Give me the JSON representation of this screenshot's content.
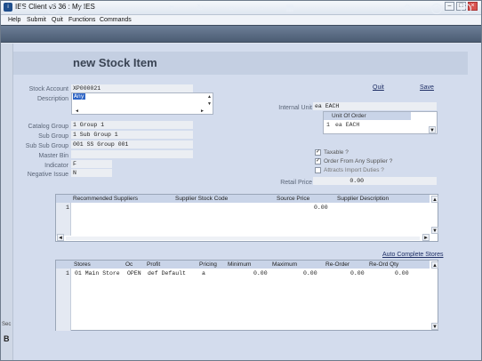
{
  "window": {
    "title": "IES Client v8.36 : My IES"
  },
  "menu": [
    "Help",
    "Submit",
    "Quit",
    "Functions",
    "Commands"
  ],
  "toolbar_icons": [
    "key-icon",
    "help-icon",
    "search-icon",
    "heart-icon",
    "refresh-icon",
    "first-icon",
    "last-icon",
    "grid-icon",
    "settings-icon",
    "confirm-icon",
    "close-icon"
  ],
  "left_strip": {
    "sec": "Sec",
    "b": "B"
  },
  "page": {
    "title": "new Stock Item",
    "quit": "Quit",
    "save": "Save"
  },
  "form": {
    "stock_account": {
      "label": "Stock Account",
      "value": "XP000021"
    },
    "description": {
      "label": "Description",
      "value": "Any"
    },
    "internal_unit": {
      "label": "Internal Unit",
      "value": "ea EACH"
    },
    "unit_of_order": {
      "header": "Unit Of Order",
      "row_num": "1",
      "value": "ea EACH"
    },
    "catalog_group": {
      "label": "Catalog Group",
      "value": "1 Group 1"
    },
    "sub_group": {
      "label": "Sub Group",
      "value": "1 Sub Group 1"
    },
    "sub_sub_group": {
      "label": "Sub Sub Group",
      "value": "001 SS Group 001"
    },
    "master_bin": {
      "label": "Master Bin",
      "value": ""
    },
    "indicator": {
      "label": "Indicator",
      "value": "F"
    },
    "negative_issue": {
      "label": "Negative Issue",
      "value": "N"
    },
    "taxable": {
      "label": "Taxable ?",
      "checked": true
    },
    "order_any_supplier": {
      "label": "Order From Any Supplier ?",
      "checked": true
    },
    "attracts_import": {
      "label": "Attracts Import Duties ?",
      "checked": false
    },
    "retail_price": {
      "label": "Retail Price",
      "value": "0.00"
    }
  },
  "suppliers": {
    "columns": [
      "Recommended Suppliers",
      "Supplier Stock Code",
      "Source Price",
      "Supplier Description"
    ],
    "rows": [
      {
        "num": "1",
        "price": "0.00"
      }
    ]
  },
  "auto_complete": "Auto Complete Stores",
  "stores": {
    "columns": [
      "Stores",
      "Oc",
      "Profit",
      "Pricing",
      "Minimum",
      "Maximum",
      "Re-Order",
      "Re-Ord Qty"
    ],
    "rows": [
      {
        "num": "1",
        "store": "01 Main Store",
        "oc": "OPEN",
        "profit": "def Default",
        "pricing": "a",
        "minimum": "0.00",
        "maximum": "0.00",
        "reorder": "0.00",
        "reord_qty": "0.00"
      }
    ]
  }
}
